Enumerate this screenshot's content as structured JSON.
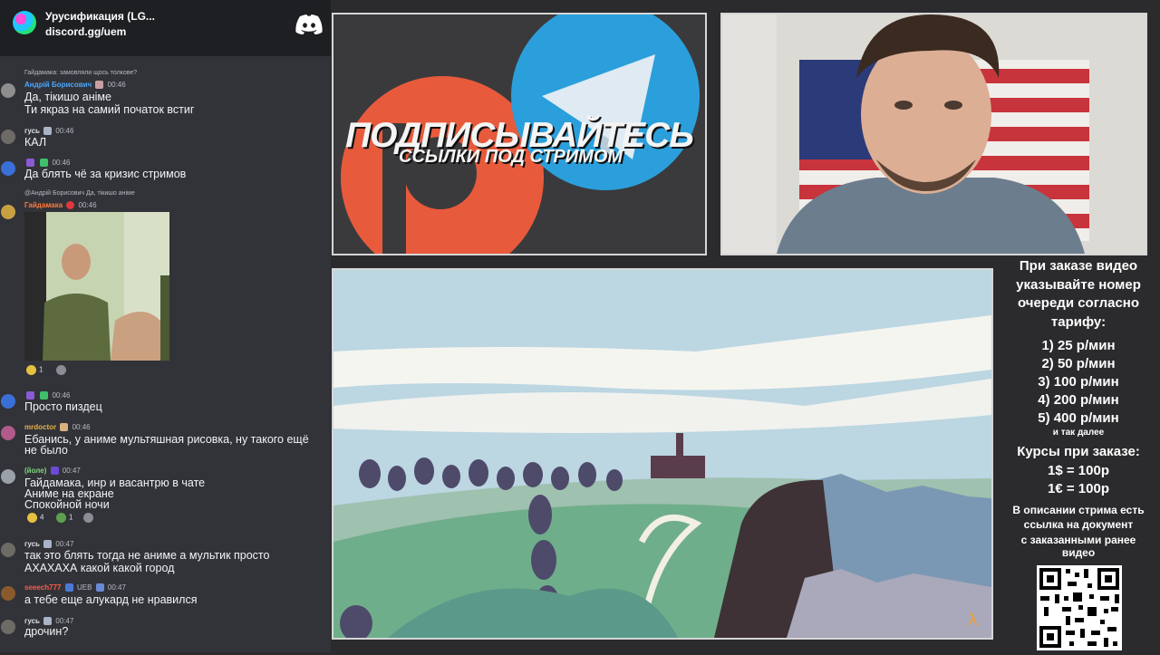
{
  "server": {
    "name": "Урусификация (LG...",
    "link": "discord.gg/uem"
  },
  "chat": {
    "messages": [
      {
        "reply": "Гайдамака: замовляли щось толкове?"
      },
      {
        "user": "Андрій Борисович",
        "time": "00:46",
        "color": "#4aa8ff",
        "lines": [
          "Да, тікишо аніме",
          "Ти якраз на самий початок встиг"
        ]
      },
      {
        "user": "гусь",
        "time": "00:46",
        "color": "#dbdee1",
        "lines": [
          "КАЛ"
        ]
      },
      {
        "user": "",
        "time": "00:46",
        "color": "#dbdee1",
        "lines": [
          "Да блять чё за кризис стримов"
        ]
      },
      {
        "reply": "@Андрій Борисович Да, тікишо аніме"
      },
      {
        "user": "Гайдамака",
        "time": "00:46",
        "color": "#ff7a3d",
        "lines": []
      },
      {
        "user": "",
        "time": "00:46",
        "color": "#dbdee1",
        "lines": [
          "Просто пиздец"
        ]
      },
      {
        "user": "mrdoctor",
        "time": "00:46",
        "color": "#e8b04a",
        "lines": [
          "Ебанись, у аниме мультяшная рисовка, ну такого ещё",
          "не было"
        ]
      },
      {
        "user": "(йоле)",
        "time": "00:47",
        "color": "#7fd67f",
        "lines": [
          "Гайдамака, инр и васантрю в чате",
          "Аниме на екране",
          "Спокойной ночи"
        ]
      },
      {
        "user": "гусь",
        "time": "00:47",
        "color": "#dbdee1",
        "lines": [
          "так это блять тогда не аниме а мультик просто",
          "АХАХАХА какой какой город"
        ]
      },
      {
        "user": "seeech777",
        "time": "00:47",
        "tag": "UEB",
        "color": "#ff5a4a",
        "lines": [
          "а тебе еще алукард не нравился"
        ]
      },
      {
        "user": "гусь",
        "time": "00:47",
        "color": "#dbdee1",
        "lines": [
          "дрочин?"
        ]
      }
    ],
    "reactions_1": [
      {
        "count": "1"
      },
      {
        "count": ""
      }
    ],
    "reactions_2": [
      {
        "count": "4"
      },
      {
        "count": "1"
      },
      {
        "count": ""
      }
    ]
  },
  "banner": {
    "title": "ПОДПИСЫВАЙТЕСЬ",
    "subtitle": "ССЫЛКИ ПОД СТРИМОМ"
  },
  "info": {
    "header": [
      "При заказе видео",
      "указывайте номер",
      "очереди согласно",
      "тарифу:"
    ],
    "tariffs": [
      "1) 25 р/мин",
      "2) 50 р/мин",
      "3) 100 р/мин",
      "4) 200 р/мин",
      "5) 400 р/мин"
    ],
    "etc": "и так далее",
    "rates_title": "Курсы при заказе:",
    "rates": [
      "1$ = 100р",
      "1€ = 100р"
    ],
    "note": [
      "В описании стрима есть",
      "ссылка на документ",
      "с заказанными ранее",
      "видео"
    ]
  },
  "colors": {
    "patreon": "#e85a3c",
    "telegram": "#2b9fdb",
    "chat_bg": "#323338"
  }
}
